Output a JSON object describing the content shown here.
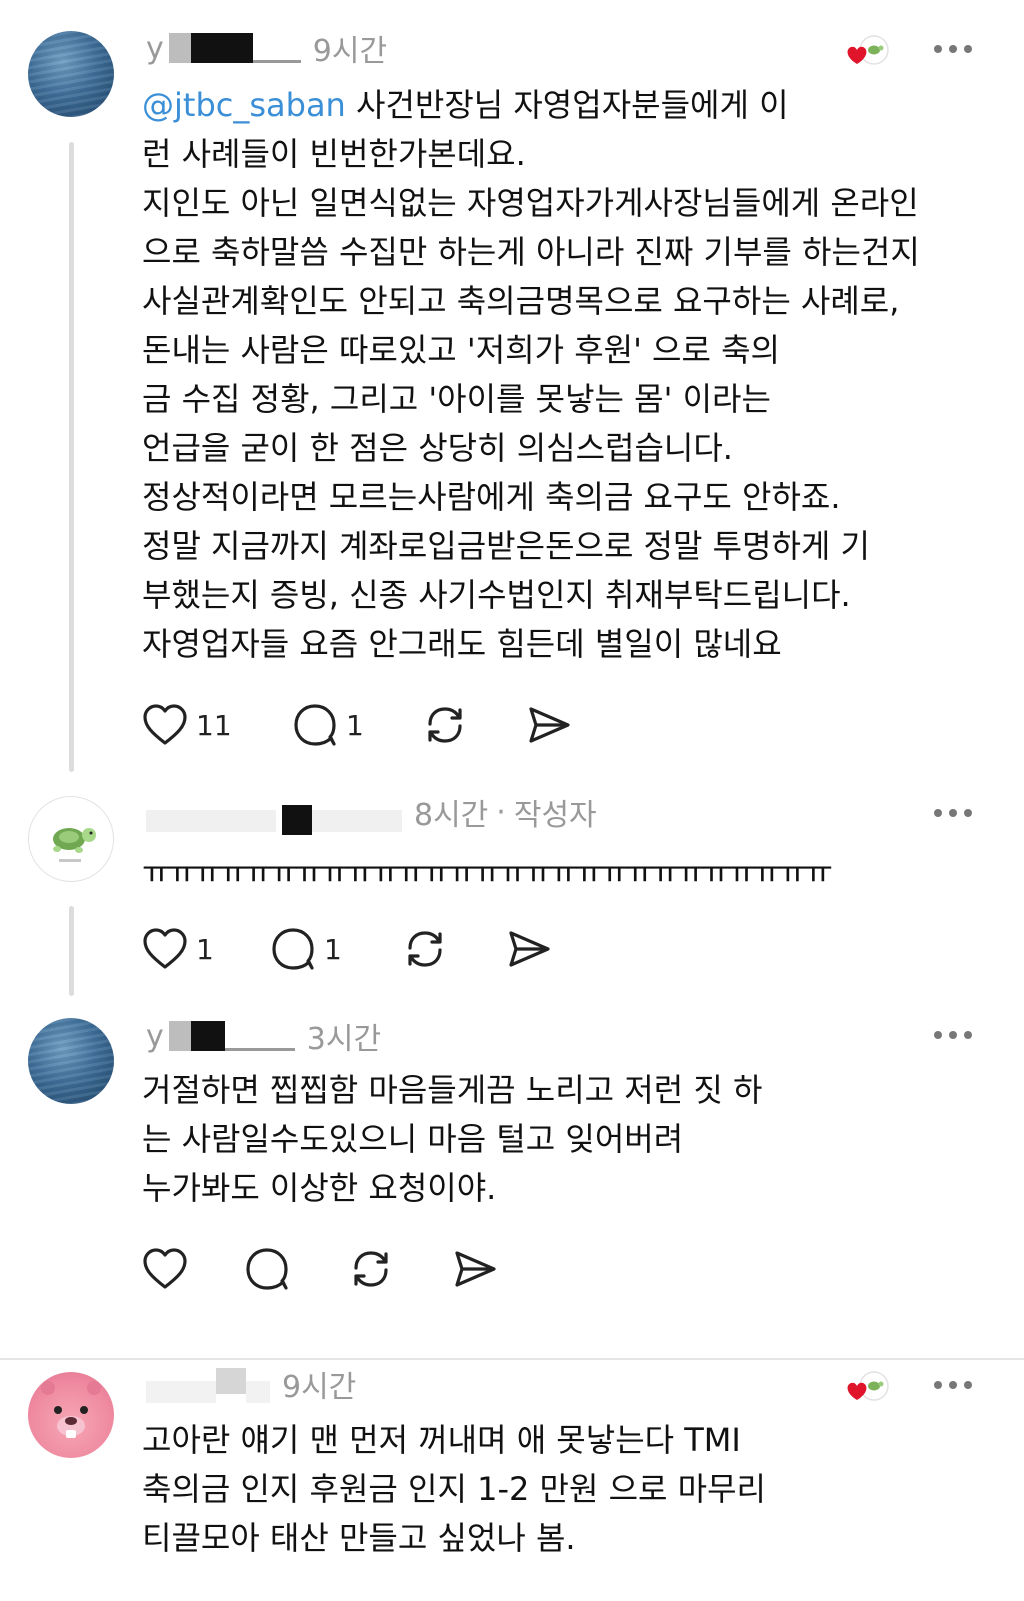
{
  "posts": [
    {
      "username_visible": "y",
      "time": "9시간",
      "author_tag": "",
      "mention": "@jtbc_saban",
      "lines": [
        " 사건반장님 자영업자분들에게 이",
        "런 사례들이 빈번한가본데요.",
        "지인도 아닌 일면식없는 자영업자가게사장님들에게 온라인",
        "으로 축하말씀 수집만 하는게 아니라 진짜 기부를 하는건지",
        "사실관계확인도 안되고 축의금명목으로 요구하는 사례로,",
        "돈내는 사람은 따로있고 '저희가 후원' 으로 축의",
        "금 수집 정황, 그리고 '아이를 못낳는 몸' 이라는",
        "언급을 굳이 한 점은 상당히 의심스럽습니다.",
        "정상적이라면 모르는사람에게 축의금 요구도 안하죠.",
        "정말 지금까지 계좌로입금받은돈으로 정말 투명하게 기",
        "부했는지 증빙, 신종 사기수법인지 취재부탁드립니다.",
        "자영업자들 요즘 안그래도 힘든데 별일이 많네요"
      ],
      "likes": "11",
      "replies": "1"
    },
    {
      "time": "8시간",
      "author_tag": "작성자",
      "lines": [
        "ㅠㅠㅠㅠㅠㅠㅠㅠㅠㅠㅠㅠㅠㅠㅠㅠㅠㅠㅠㅠㅠㅠㅠㅠㅠㅠㅠ"
      ],
      "likes": "1",
      "replies": "1"
    },
    {
      "username_visible": "y",
      "time": "3시간",
      "lines": [
        "거절하면 찝찝함 마음들게끔 노리고 저런 짓 하",
        "는 사람일수도있으니 마음 털고 잊어버려",
        "누가봐도 이상한 요청이야."
      ],
      "likes": "",
      "replies": ""
    },
    {
      "time": "9시간",
      "lines": [
        "고아란 얘기 맨 먼저 꺼내며 애 못낳는다 TMI",
        "축의금 인지 후원금 인지 1-2 만원 으로 마무리",
        "티끌모아 태산 만들고 싶었나 봄."
      ]
    }
  ],
  "icons": {
    "like": "heart-icon",
    "reply": "comment-bubble-icon",
    "repost": "repost-icon",
    "share": "send-icon",
    "more": "more-dots-icon"
  },
  "colors": {
    "mention": "#3b8fd6",
    "liked_heart": "#e0142b",
    "meta_gray": "#999999"
  }
}
